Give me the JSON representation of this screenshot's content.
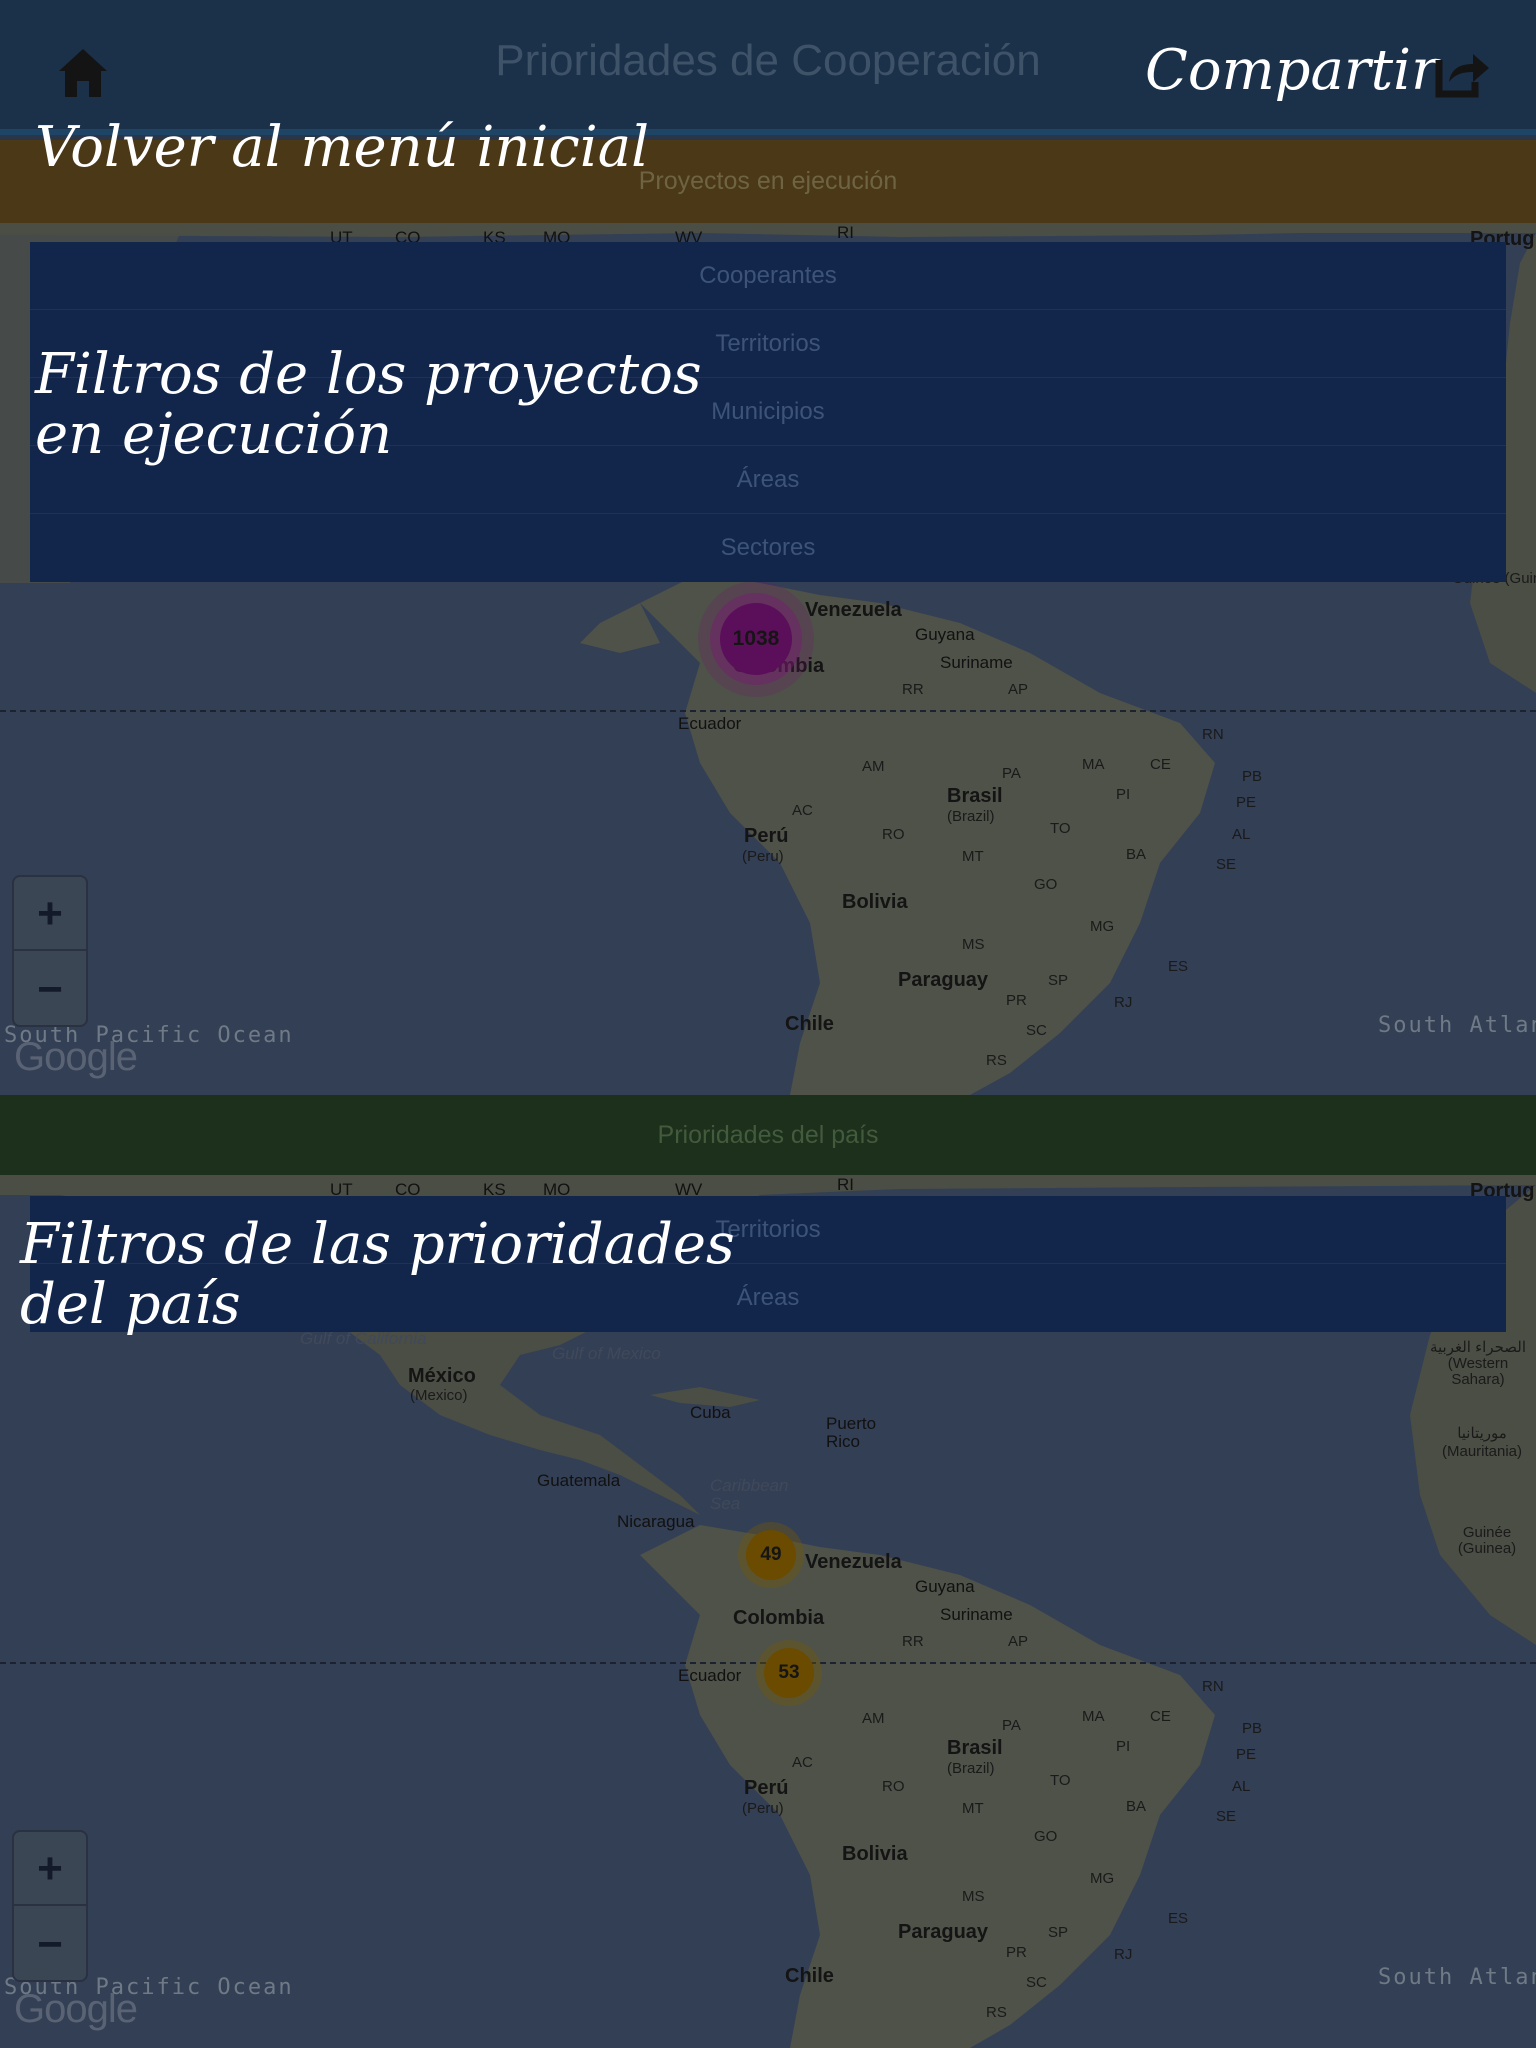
{
  "header": {
    "title": "Prioridades de Cooperación",
    "share_label": "Compartir"
  },
  "annotations": {
    "home": "Volver al menú inicial",
    "project_filters_line1": "Filtros de los proyectos",
    "project_filters_line2": "en ejecución",
    "priority_filters_line1": "Filtros de las prioridades",
    "priority_filters_line2": "del país"
  },
  "projects_section": {
    "title": "Proyectos en ejecución",
    "filters": [
      "Cooperantes",
      "Territorios",
      "Municipios",
      "Áreas",
      "Sectores"
    ],
    "cluster_count": "1038"
  },
  "priorities_section": {
    "title": "Prioridades del país",
    "filters": [
      "Territorios",
      "Áreas"
    ],
    "clusters": [
      "49",
      "53"
    ]
  },
  "map": {
    "zoom_in": "+",
    "zoom_out": "−",
    "attribution": "Google",
    "labels": {
      "venezuela": "Venezuela",
      "colombia": "Colombia",
      "guyana": "Guyana",
      "suriname": "Suriname",
      "ecuador": "Ecuador",
      "brasil": "Brasil",
      "brazil": "(Brazil)",
      "peru": "Perú",
      "peru_en": "(Peru)",
      "bolivia": "Bolivia",
      "paraguay": "Paraguay",
      "chile": "Chile",
      "mexico": "México",
      "mexico_en": "(Mexico)",
      "cuba": "Cuba",
      "puerto_rico": "Puerto Rico",
      "guatemala": "Guatemala",
      "nicaragua": "Nicaragua",
      "caribbean": "Caribbean Sea",
      "gulf_california": "Gulf of California",
      "gulf_mexico": "Gulf of Mexico",
      "south_pacific": "South Pacific Ocean",
      "south_atlantic": "South Atlantic Ocean",
      "portugal": "Portug",
      "guinee": "Guinée (Guinea)",
      "mauritania": "موريتانيا (Mauritania)",
      "sahara": "الصحراء الغربية (Western Sahara)"
    },
    "states": [
      "RR",
      "AP",
      "AM",
      "PA",
      "MA",
      "CE",
      "RN",
      "PB",
      "PE",
      "AL",
      "SE",
      "PI",
      "AC",
      "RO",
      "TO",
      "BA",
      "MT",
      "GO",
      "MG",
      "ES",
      "MS",
      "SP",
      "RJ",
      "PR",
      "SC",
      "RS"
    ],
    "us_states": [
      "UT",
      "CO",
      "KS",
      "MO",
      "WV",
      "RI"
    ]
  },
  "colors": {
    "header_bg": "#1b3049",
    "projects_bar": "#4a3816",
    "priorities_bar": "#1c301b",
    "filter_panel": "#11264a",
    "cluster_projects": "#5b0f5a",
    "cluster_priorities": "#6a4b00"
  },
  "icons": [
    "home-icon",
    "share-icon",
    "zoom-in-icon",
    "zoom-out-icon"
  ]
}
